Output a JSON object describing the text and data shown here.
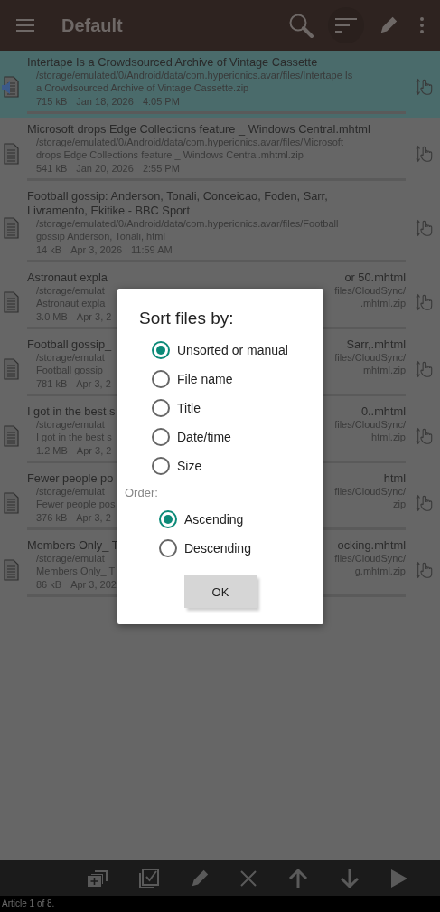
{
  "toolbar": {
    "title": "Default"
  },
  "files": [
    {
      "kind": "audio",
      "selected": true,
      "title_lines": [
        [
          "Intertape Is a Crowdsourced Archive of Vintage Cassette"
        ]
      ],
      "path_lines": [
        [
          "/storage/emulated/0/Android/data/com.hyperionics.avar/files/Intertape Is"
        ],
        [
          "a Crowdsourced Archive of Vintage Cassette.zip"
        ]
      ],
      "meta": [
        "715 kB",
        "Jan 18, 2026",
        "4:05 PM"
      ]
    },
    {
      "kind": "document",
      "selected": false,
      "title_lines": [
        [
          "Microsoft drops Edge Collections feature _ Windows Central.mhtml"
        ]
      ],
      "path_lines": [
        [
          "/storage/emulated/0/Android/data/com.hyperionics.avar/files/Microsoft"
        ],
        [
          "drops Edge Collections feature _ Windows Central.mhtml.zip"
        ]
      ],
      "meta": [
        "541 kB",
        "Jan 20, 2026",
        "2:55 PM"
      ]
    },
    {
      "kind": "document",
      "selected": false,
      "title_lines": [
        [
          "Football gossip: Anderson, Tonali, Conceicao, Foden, Sarr,"
        ],
        [
          "Livramento, Ekitike - BBC Sport"
        ]
      ],
      "path_lines": [
        [
          "/storage/emulated/0/Android/data/com.hyperionics.avar/files/Football"
        ],
        [
          "gossip Anderson, Tonali,.html"
        ]
      ],
      "meta": [
        "14 kB",
        "Apr 3, 2026",
        "11:59 AM"
      ]
    },
    {
      "kind": "document",
      "selected": false,
      "title_lines": [
        [
          "Astronaut expla",
          "or 50.mhtml"
        ]
      ],
      "path_lines": [
        [
          "/storage/emulat",
          "files/CloudSync/"
        ],
        [
          "Astronaut expla",
          ".mhtml.zip"
        ]
      ],
      "meta": [
        "3.0 MB",
        "Apr 3, 2"
      ]
    },
    {
      "kind": "document",
      "selected": false,
      "title_lines": [
        [
          "Football gossip_",
          "Sarr,.mhtml"
        ]
      ],
      "path_lines": [
        [
          "/storage/emulat",
          "files/CloudSync/"
        ],
        [
          "Football gossip_",
          "mhtml.zip"
        ]
      ],
      "meta": [
        "781 kB",
        "Apr 3, 2"
      ]
    },
    {
      "kind": "document",
      "selected": false,
      "title_lines": [
        [
          "I got in the best s",
          "0..mhtml"
        ]
      ],
      "path_lines": [
        [
          "/storage/emulat",
          "files/CloudSync/"
        ],
        [
          "I got in the best s",
          "html.zip"
        ]
      ],
      "meta": [
        "1.2 MB",
        "Apr 3, 2"
      ]
    },
    {
      "kind": "document",
      "selected": false,
      "title_lines": [
        [
          "Fewer people po",
          "html"
        ]
      ],
      "path_lines": [
        [
          "/storage/emulat",
          "files/CloudSync/"
        ],
        [
          "Fewer people pos",
          "zip"
        ]
      ],
      "meta": [
        "376 kB",
        "Apr 3, 2"
      ]
    },
    {
      "kind": "document",
      "selected": false,
      "title_lines": [
        [
          "Members Only_ T",
          "ocking.mhtml"
        ]
      ],
      "path_lines": [
        [
          "/storage/emulat",
          "files/CloudSync/"
        ],
        [
          "Members Only_ T",
          "g.mhtml.zip"
        ]
      ],
      "meta": [
        "86 kB",
        "Apr 3, 202"
      ]
    }
  ],
  "dialog": {
    "title": "Sort files by:",
    "sort_options": [
      {
        "label": "Unsorted or manual",
        "selected": true
      },
      {
        "label": "File name",
        "selected": false
      },
      {
        "label": "Title",
        "selected": false
      },
      {
        "label": "Date/time",
        "selected": false
      },
      {
        "label": "Size",
        "selected": false
      }
    ],
    "order_label": "Order:",
    "order_options": [
      {
        "label": "Ascending",
        "selected": true
      },
      {
        "label": "Descending",
        "selected": false
      }
    ],
    "ok": "OK"
  },
  "status_bar": "Article 1 of 8."
}
